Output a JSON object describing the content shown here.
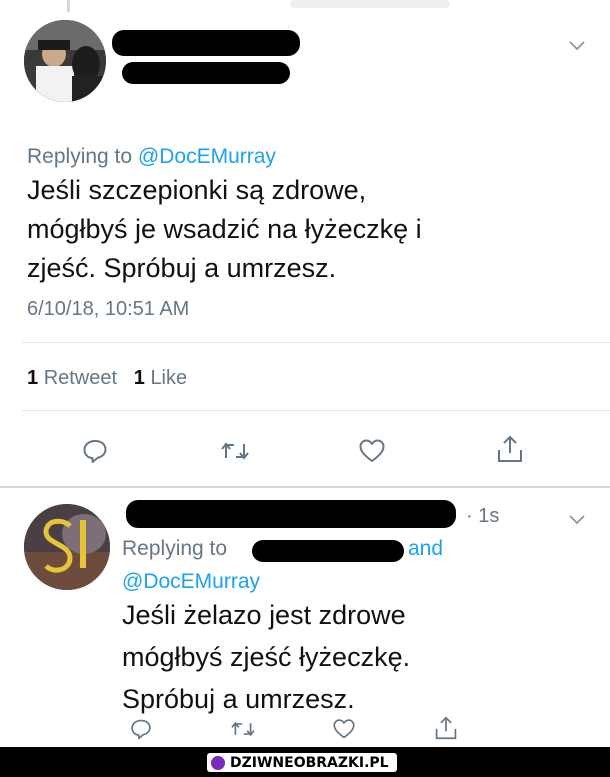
{
  "tweet1": {
    "replying_label": "Replying to",
    "replying_handle": "@DocEMurray",
    "text_lines": [
      "Jeśli szczepionki są zdrowe,",
      "mógłbyś je wsadzić na łyżeczkę i",
      "zjeść. Spróbuj a umrzesz."
    ],
    "timestamp": "6/10/18, 10:51 AM",
    "retweet_count": "1",
    "retweet_label": "Retweet",
    "like_count": "1",
    "like_label": "Like"
  },
  "tweet2": {
    "time_ago": "· 1s",
    "replying_label": "Replying to",
    "and_label": "and",
    "replying_handle": "@DocEMurray",
    "text_lines": [
      "Jeśli żelazo jest zdrowe",
      "mógłbyś zjeść łyżeczkę.",
      "Spróbuj a umrzesz."
    ]
  },
  "icons": {
    "reply": "reply-icon",
    "retweet": "retweet-icon",
    "like": "heart-icon",
    "share": "share-icon",
    "more": "chevron-down-icon"
  },
  "colors": {
    "link": "#1da1f2",
    "muted": "#657786",
    "icon": "#657786",
    "divider": "#e1e8ed"
  },
  "watermark": {
    "text": "DZIWNEOBRAZKI.PL"
  }
}
